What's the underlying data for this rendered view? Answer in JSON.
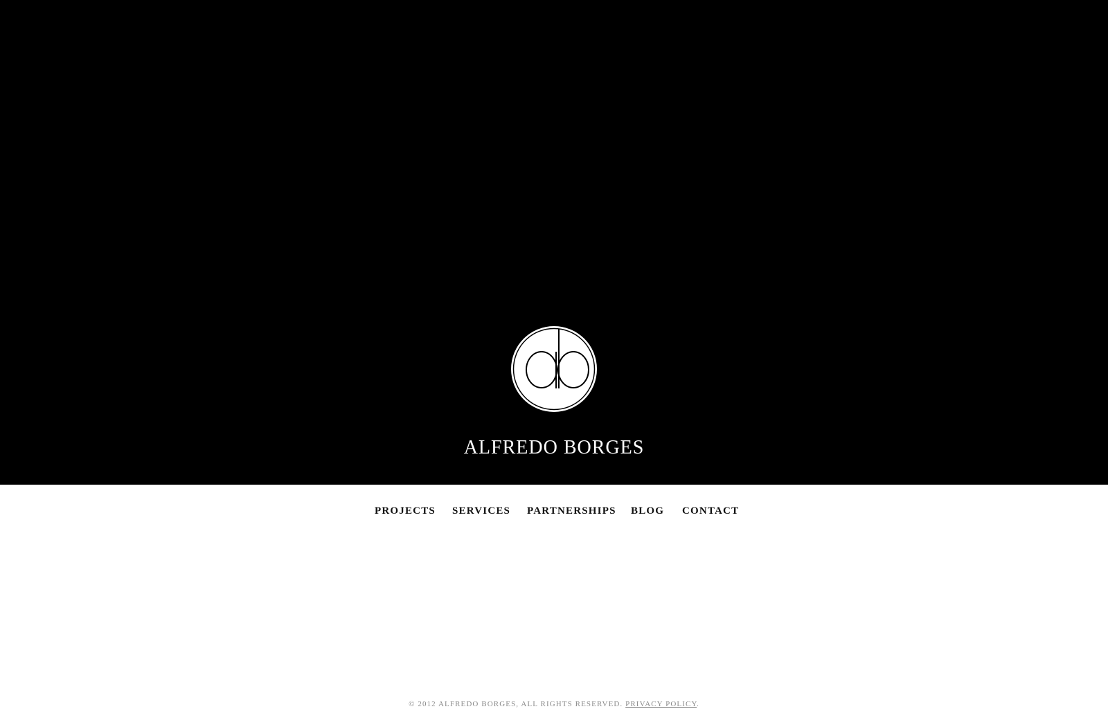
{
  "site": {
    "logo_letters": "ab",
    "title": "ALFREDO BORGES"
  },
  "nav": {
    "items": [
      {
        "label": "PROJECTS"
      },
      {
        "label": "SERVICES"
      },
      {
        "label": "PARTNERSHIPS"
      },
      {
        "label": "BLOG"
      },
      {
        "label": "CONTACT"
      }
    ]
  },
  "footer": {
    "copyright": "© 2012 ALFREDO BORGES, ALL RIGHTS RESERVED.",
    "privacy_link": "PRIVACY POLICY",
    "trailing": "."
  },
  "colors": {
    "hero_background": "#000000",
    "page_background": "#ffffff",
    "nav_text": "#111111",
    "footer_text": "#8a8a8a"
  }
}
